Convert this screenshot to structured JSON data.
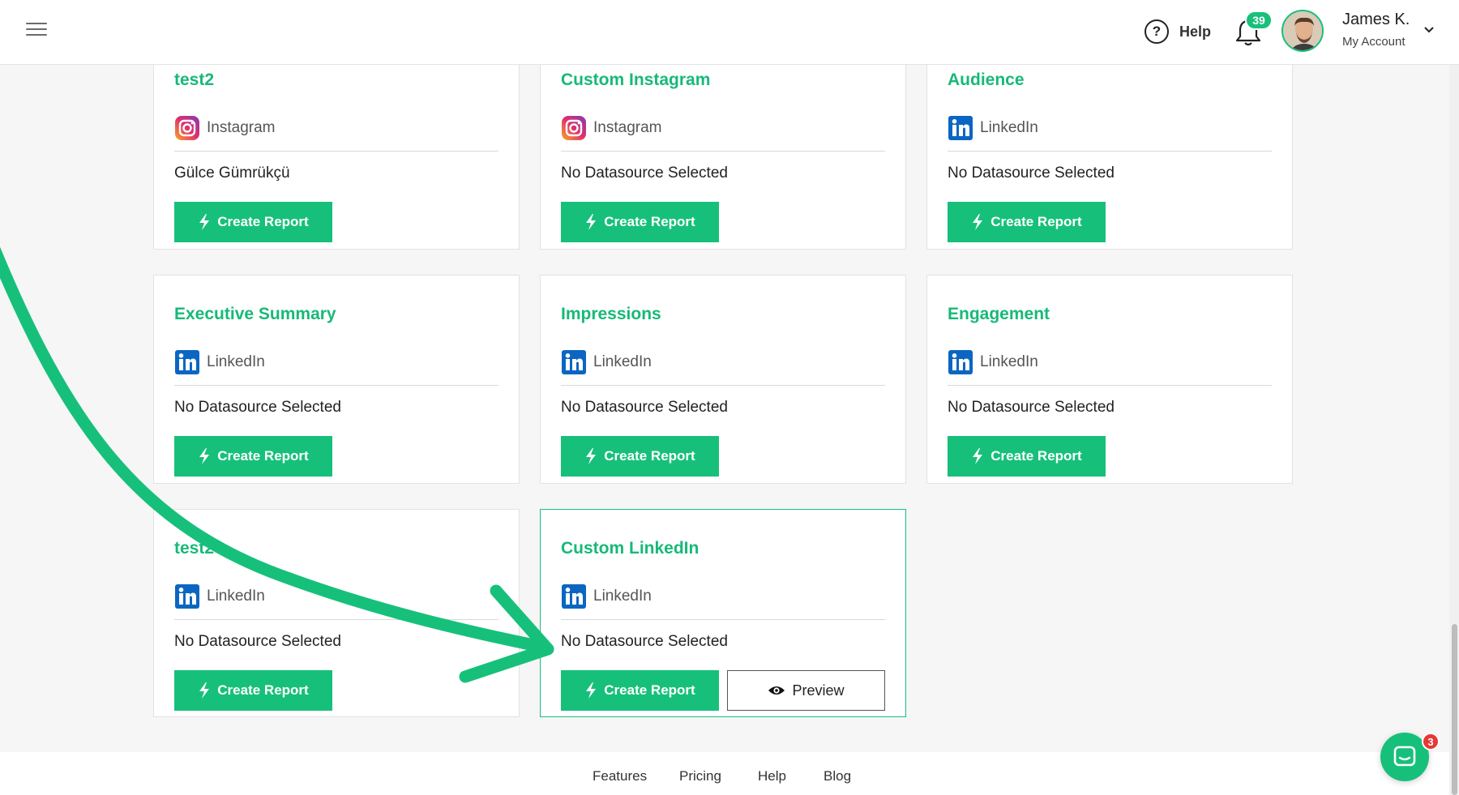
{
  "header": {
    "help_label": "Help",
    "notification_count": "39",
    "user_name": "James K.",
    "user_sub": "My Account"
  },
  "cards": [
    {
      "title": "test2",
      "platform": "Instagram",
      "platform_icon": "instagram-icon",
      "datasource": "Gülce Gümrükçü",
      "button": "Create Report"
    },
    {
      "title": "Custom Instagram",
      "platform": "Instagram",
      "platform_icon": "instagram-icon",
      "datasource": "No Datasource Selected",
      "button": "Create Report"
    },
    {
      "title": "Audience",
      "platform": "LinkedIn",
      "platform_icon": "linkedin-icon",
      "datasource": "No Datasource Selected",
      "button": "Create Report"
    },
    {
      "title": "Executive Summary",
      "platform": "LinkedIn",
      "platform_icon": "linkedin-icon",
      "datasource": "No Datasource Selected",
      "button": "Create Report"
    },
    {
      "title": "Impressions",
      "platform": "LinkedIn",
      "platform_icon": "linkedin-icon",
      "datasource": "No Datasource Selected",
      "button": "Create Report"
    },
    {
      "title": "Engagement",
      "platform": "LinkedIn",
      "platform_icon": "linkedin-icon",
      "datasource": "No Datasource Selected",
      "button": "Create Report"
    },
    {
      "title": "test2",
      "platform": "LinkedIn",
      "platform_icon": "linkedin-icon",
      "datasource": "No Datasource Selected",
      "button": "Create Report"
    },
    {
      "title": "Custom LinkedIn",
      "platform": "LinkedIn",
      "platform_icon": "linkedin-icon",
      "datasource": "No Datasource Selected",
      "button": "Create Report",
      "preview_label": "Preview"
    }
  ],
  "footer": {
    "links": [
      "Features",
      "Pricing",
      "Help",
      "Blog"
    ]
  },
  "chat": {
    "badge_count": "3"
  },
  "colors": {
    "accent": "#17c07a",
    "title_green": "#17b978",
    "linkedin_blue": "#0a66c2",
    "badge_red": "#e53935"
  }
}
